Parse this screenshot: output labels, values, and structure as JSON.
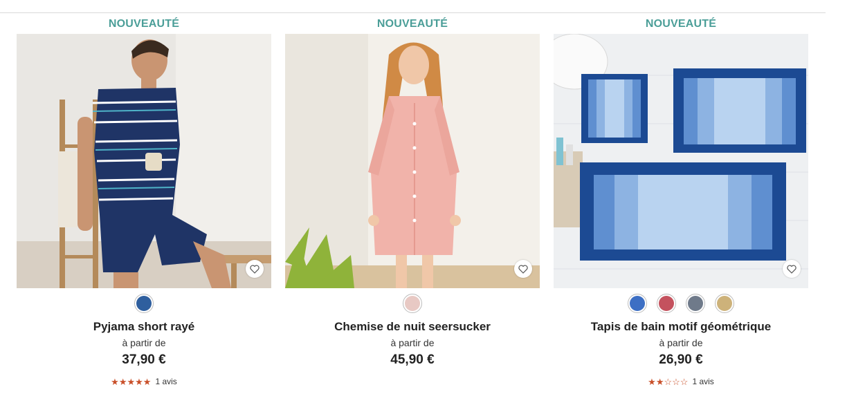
{
  "products": [
    {
      "badge": "NOUVEAUTÉ",
      "image_alt": "homme en pyjama rayé",
      "swatches": [
        "#2f5f9e"
      ],
      "name": "Pyjama short rayé",
      "from_label": "à partir de",
      "price": "37,90 €",
      "rating": 5,
      "reviews": "1 avis"
    },
    {
      "badge": "NOUVEAUTÉ",
      "image_alt": "femme en chemise de nuit rose",
      "swatches": [
        "#e8c9c4"
      ],
      "name": "Chemise de nuit seersucker",
      "from_label": "à partir de",
      "price": "45,90 €",
      "rating": null,
      "reviews": ""
    },
    {
      "badge": "NOUVEAUTÉ",
      "image_alt": "tapis de bain bleus",
      "swatches": [
        "#3d6fc4",
        "#c4525e",
        "#6f7a8a",
        "#cdb27a"
      ],
      "name": "Tapis de bain motif géométrique",
      "from_label": "à partir de",
      "price": "26,90 €",
      "rating": 2,
      "reviews": "1 avis"
    }
  ],
  "colors": {
    "accent": "#4b9e98",
    "star": "#c9502a"
  }
}
